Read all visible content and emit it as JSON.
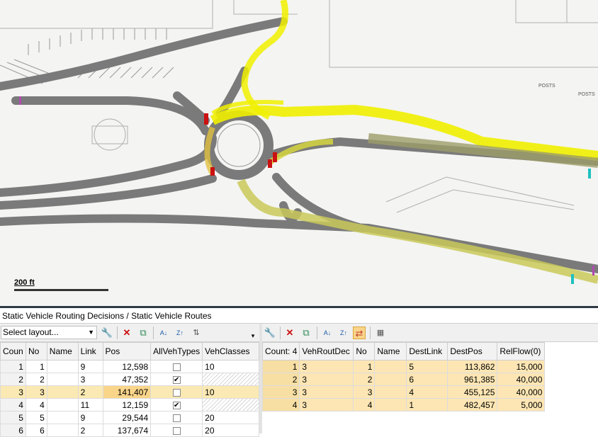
{
  "map": {
    "scale_label": "200 ft",
    "labels": [
      "POSTS",
      "POSTS"
    ],
    "colors": {
      "road": "#7a7a7a",
      "route": "#f0f000",
      "link_alt": "#8c8c5a",
      "conflict": "#cc1111",
      "background": "#f4f4f2"
    }
  },
  "panel": {
    "title": "Static Vehicle Routing Decisions / Static Vehicle Routes"
  },
  "left_toolbar": {
    "layout_select": "Select layout...",
    "icons": [
      "wrench-icon",
      "delete-icon",
      "duplicate-icon",
      "sort-ascending-icon",
      "sort-descending-icon",
      "clear-sort-icon",
      "dropdown-icon"
    ]
  },
  "right_toolbar": {
    "icons": [
      "wrench-icon",
      "delete-icon",
      "duplicate-icon",
      "sort-ascending-icon",
      "sort-descending-icon",
      "sync-icon",
      "grid-icon"
    ]
  },
  "decisions": {
    "columns": [
      "Coun",
      "No",
      "Name",
      "Link",
      "Pos",
      "AllVehTypes",
      "VehClasses"
    ],
    "rows": [
      {
        "idx": "1",
        "no": "1",
        "name": "",
        "link": "9",
        "pos": "12,598",
        "allveh": "",
        "classes": "10"
      },
      {
        "idx": "2",
        "no": "2",
        "name": "",
        "link": "3",
        "pos": "47,352",
        "allveh": "✔",
        "classes": ""
      },
      {
        "idx": "3",
        "no": "3",
        "name": "",
        "link": "2",
        "pos": "141,407",
        "allveh": "",
        "classes": "10"
      },
      {
        "idx": "4",
        "no": "4",
        "name": "",
        "link": "11",
        "pos": "12,159",
        "allveh": "✔",
        "classes": ""
      },
      {
        "idx": "5",
        "no": "5",
        "name": "",
        "link": "9",
        "pos": "29,544",
        "allveh": "",
        "classes": "20"
      },
      {
        "idx": "6",
        "no": "6",
        "name": "",
        "link": "2",
        "pos": "137,674",
        "allveh": "",
        "classes": "20"
      }
    ]
  },
  "routes": {
    "columns": [
      "Count: 4",
      "VehRoutDec",
      "No",
      "Name",
      "DestLink",
      "DestPos",
      "RelFlow(0)"
    ],
    "rows": [
      {
        "idx": "1",
        "dec": "3",
        "no": "1",
        "name": "",
        "dest": "5",
        "destpos": "113,862",
        "flow": "15,000"
      },
      {
        "idx": "2",
        "dec": "3",
        "no": "2",
        "name": "",
        "dest": "6",
        "destpos": "961,385",
        "flow": "40,000"
      },
      {
        "idx": "3",
        "dec": "3",
        "no": "3",
        "name": "",
        "dest": "4",
        "destpos": "455,125",
        "flow": "40,000"
      },
      {
        "idx": "4",
        "dec": "3",
        "no": "4",
        "name": "",
        "dest": "1",
        "destpos": "482,457",
        "flow": "5,000"
      }
    ]
  }
}
